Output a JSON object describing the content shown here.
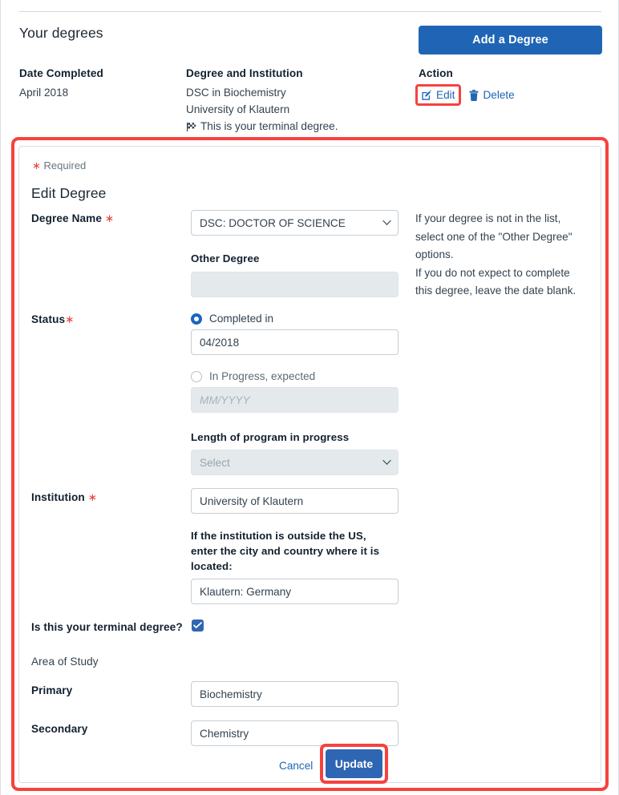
{
  "degrees_section": {
    "title": "Your degrees",
    "add_button": "Add a Degree",
    "columns": {
      "date": "Date Completed",
      "degree": "Degree and Institution",
      "action": "Action"
    },
    "row": {
      "date_completed": "April 2018",
      "degree": "DSC in Biochemistry",
      "institution": "University of Klautern",
      "terminal_note": "This is your terminal degree.",
      "edit_label": "Edit",
      "delete_label": "Delete"
    }
  },
  "edit_form": {
    "required_note": "Required",
    "required_star": "∗",
    "title": "Edit Degree",
    "degree_name": {
      "label": "Degree Name",
      "value": "DSC: DOCTOR OF SCIENCE"
    },
    "other_degree": {
      "label": "Other Degree",
      "value": "",
      "placeholder": ""
    },
    "help": {
      "line1": "If your degree is not in the list,",
      "line2": "select one of the \"Other Degree\"",
      "line3": "options.",
      "line4": "If you do not expect to complete",
      "line5": "this degree, leave the date blank."
    },
    "status": {
      "label": "Status",
      "completed_label": "Completed in",
      "completed_value": "04/2018",
      "in_progress_label": "In Progress, expected",
      "in_progress_value": "",
      "in_progress_placeholder": "MM/YYYY",
      "length_label": "Length of program in progress",
      "length_value": "Select"
    },
    "institution": {
      "label": "Institution",
      "value": "University of Klautern",
      "outside_us_line1": "If the institution is outside the US,",
      "outside_us_line2": "enter the city and country where it is",
      "outside_us_line3": "located:",
      "city_country_value": "Klautern: Germany"
    },
    "terminal_degree": {
      "label": "Is this your terminal degree?",
      "checked": true
    },
    "area_of_study": {
      "label": "Area of Study",
      "primary_label": "Primary",
      "primary_value": "Biochemistry",
      "secondary_label": "Secondary",
      "secondary_value": "Chemistry"
    },
    "actions": {
      "cancel_label": "Cancel",
      "update_label": "Update"
    }
  },
  "icons": {
    "edit": "pencil-square-icon",
    "delete": "trash-icon",
    "flag": "checkered-flag-icon",
    "chevron": "chevron-down-icon",
    "check": "check-icon"
  },
  "colors": {
    "primary_blue": "#2065b5",
    "button_blue": "#2f66b3",
    "highlight_red": "#f6423e",
    "required_red": "#e8413d",
    "disabled_gray": "#e4e9ec"
  }
}
